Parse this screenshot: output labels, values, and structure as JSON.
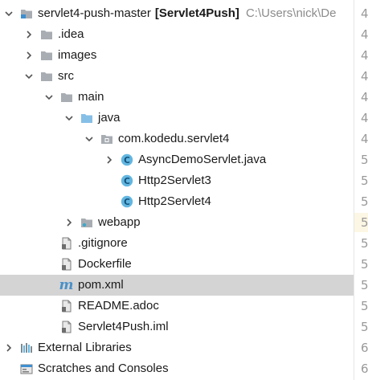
{
  "project_tree": {
    "root": {
      "name": "servlet4-push-master",
      "module": "[Servlet4Push]",
      "path": "C:\\Users\\nick\\De"
    },
    "items": [
      {
        "label": "servlet4-push-master",
        "indent": 0,
        "arrow": "down",
        "icon": "module-folder"
      },
      {
        "label": ".idea",
        "indent": 1,
        "arrow": "right",
        "icon": "folder"
      },
      {
        "label": "images",
        "indent": 1,
        "arrow": "right",
        "icon": "folder"
      },
      {
        "label": "src",
        "indent": 1,
        "arrow": "down",
        "icon": "folder"
      },
      {
        "label": "main",
        "indent": 2,
        "arrow": "down",
        "icon": "folder"
      },
      {
        "label": "java",
        "indent": 3,
        "arrow": "down",
        "icon": "source-folder"
      },
      {
        "label": "com.kodedu.servlet4",
        "indent": 4,
        "arrow": "down",
        "icon": "package-folder"
      },
      {
        "label": "AsyncDemoServlet.java",
        "indent": 5,
        "arrow": "right",
        "icon": "java-class"
      },
      {
        "label": "Http2Servlet3",
        "indent": 5,
        "arrow": "none",
        "icon": "java-class"
      },
      {
        "label": "Http2Servlet4",
        "indent": 5,
        "arrow": "none",
        "icon": "java-class"
      },
      {
        "label": "webapp",
        "indent": 3,
        "arrow": "right",
        "icon": "web-folder"
      },
      {
        "label": ".gitignore",
        "indent": 2,
        "arrow": "none",
        "icon": "file"
      },
      {
        "label": "Dockerfile",
        "indent": 2,
        "arrow": "none",
        "icon": "file"
      },
      {
        "label": "pom.xml",
        "indent": 2,
        "arrow": "none",
        "icon": "maven-file",
        "selected": true
      },
      {
        "label": "README.adoc",
        "indent": 2,
        "arrow": "none",
        "icon": "file"
      },
      {
        "label": "Servlet4Push.iml",
        "indent": 2,
        "arrow": "none",
        "icon": "file"
      },
      {
        "label": "External Libraries",
        "indent": 0,
        "arrow": "right",
        "icon": "libraries"
      },
      {
        "label": "Scratches and Consoles",
        "indent": 0,
        "arrow": "none",
        "icon": "scratches"
      }
    ]
  },
  "gutter": {
    "line_numbers": [
      "4",
      "4",
      "4",
      "4",
      "4",
      "4",
      "4",
      "5",
      "5",
      "5",
      "5",
      "5",
      "5",
      "5",
      "5",
      "5",
      "6",
      "6"
    ],
    "highlighted_index": 10,
    "highlight_color": "#fcf6e4"
  },
  "colors": {
    "folder": "#a8adb3",
    "source_folder": "#86bfe6",
    "class_icon": "#62b6e0",
    "maven": "#4a90c8",
    "selection": "#d4d4d4"
  }
}
